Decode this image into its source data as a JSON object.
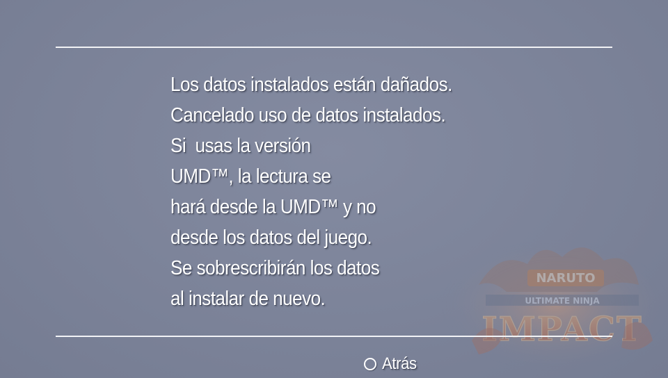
{
  "dialog": {
    "message_lines": [
      "Los datos instalados están dañados.",
      "Cancelado uso de datos instalados.",
      "Si  usas la versión",
      "UMD™, la lectura se",
      "hará desde la UMD™ y no",
      "desde los datos del juego.",
      "Se sobrescribirán los datos",
      "al instalar de nuevo."
    ]
  },
  "footer": {
    "back_label": "Atrás",
    "back_icon": "circle-button-icon"
  },
  "watermark": {
    "logo_text_top": "NARUTO",
    "logo_text_middle": "ULTIMATE NINJA",
    "logo_text_bottom": "IMPACT"
  },
  "colors": {
    "background": "#7c8399",
    "text": "#ffffff",
    "divider": "#f2f3f6",
    "logo_orange": "#e8843a",
    "logo_red": "#b8452e"
  }
}
